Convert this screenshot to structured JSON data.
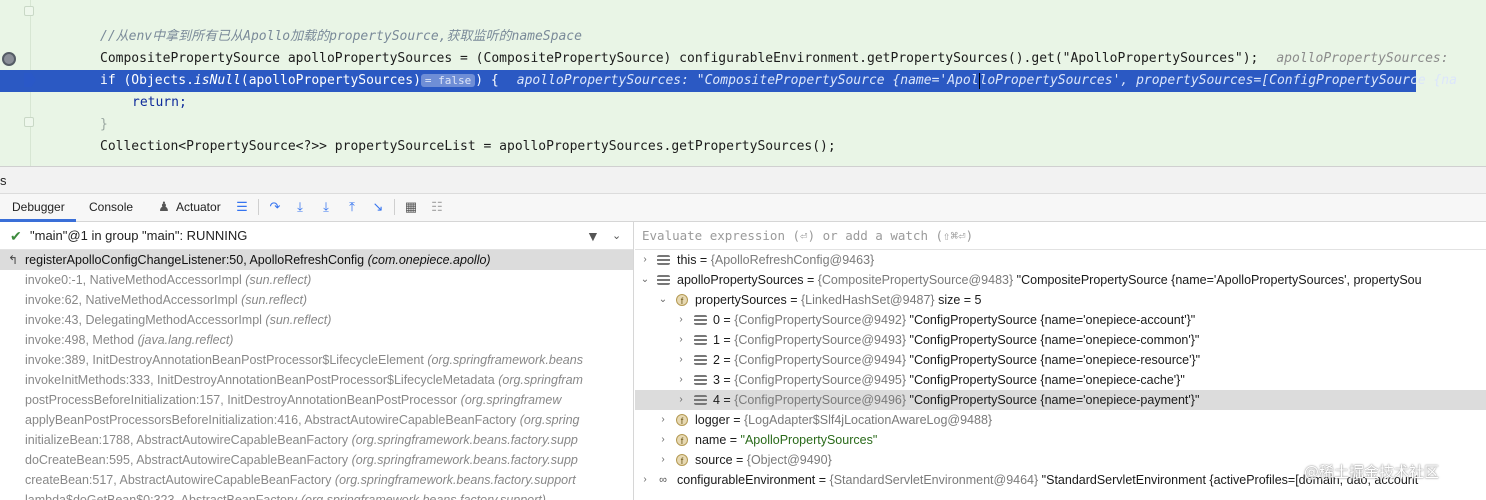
{
  "editor": {
    "comment": "//从env中拿到所有已从Apollo加载的propertySource,获取监听的nameSpace",
    "line2_code": "CompositePropertySource apolloPropertySources = (CompositePropertySource) configurableEnvironment.getPropertySources().get(\"ApolloPropertySources\");",
    "line2_hint": "apolloPropertySources:",
    "line3_code_a": "if (Objects.",
    "line3_code_b": "isNull",
    "line3_code_c": "(apolloPropertySources)",
    "line3_badge": "= false",
    "line3_code_d": ") {",
    "line3_hint_a": "apolloPropertySources: \"CompositePropertySource {name='Apol",
    "line3_hint_b": "loPropertySources', propertySources=[ConfigPropertySource {na",
    "line4": "return;",
    "line5": "}",
    "line6": "Collection<PropertySource<?>> propertySourceList = apolloPropertySources.getPropertySources();"
  },
  "tool_window": {
    "title": "s"
  },
  "tabs": {
    "debugger": "Debugger",
    "console": "Console",
    "actuator": "Actuator"
  },
  "toolbar_icons": [
    "show-execution-point-icon",
    "step-over-icon",
    "step-into-icon",
    "force-step-into-icon",
    "step-out-icon",
    "run-to-cursor-icon",
    "evaluate-expression-icon",
    "trace-icon"
  ],
  "thread": {
    "label": "\"main\"@1 in group \"main\": RUNNING"
  },
  "frames": [
    {
      "method": "registerApolloConfigChangeListener:50, ApolloRefreshConfig",
      "pkg": "(com.onepiece.apollo)",
      "selected": true
    },
    {
      "method": "invoke0:-1, NativeMethodAccessorImpl",
      "pkg": "(sun.reflect)"
    },
    {
      "method": "invoke:62, NativeMethodAccessorImpl",
      "pkg": "(sun.reflect)"
    },
    {
      "method": "invoke:43, DelegatingMethodAccessorImpl",
      "pkg": "(sun.reflect)"
    },
    {
      "method": "invoke:498, Method",
      "pkg": "(java.lang.reflect)"
    },
    {
      "method": "invoke:389, InitDestroyAnnotationBeanPostProcessor$LifecycleElement",
      "pkg": "(org.springframework.beans"
    },
    {
      "method": "invokeInitMethods:333, InitDestroyAnnotationBeanPostProcessor$LifecycleMetadata",
      "pkg": "(org.springfram"
    },
    {
      "method": "postProcessBeforeInitialization:157, InitDestroyAnnotationBeanPostProcessor",
      "pkg": "(org.springframew"
    },
    {
      "method": "applyBeanPostProcessorsBeforeInitialization:416, AbstractAutowireCapableBeanFactory",
      "pkg": "(org.spring"
    },
    {
      "method": "initializeBean:1788, AbstractAutowireCapableBeanFactory",
      "pkg": "(org.springframework.beans.factory.supp"
    },
    {
      "method": "doCreateBean:595, AbstractAutowireCapableBeanFactory",
      "pkg": "(org.springframework.beans.factory.supp"
    },
    {
      "method": "createBean:517, AbstractAutowireCapableBeanFactory",
      "pkg": "(org.springframework.beans.factory.support"
    },
    {
      "method": "lambda$doGetBean$0:323, AbstractBeanFactory",
      "pkg": "(org.springframework.beans.factory.support)"
    }
  ],
  "evaluate": {
    "placeholder": "Evaluate expression (⏎) or add a watch (⇧⌘⏎)"
  },
  "variables": {
    "this": {
      "name": "this",
      "ref": "{ApolloRefreshConfig@9463}"
    },
    "aps": {
      "name": "apolloPropertySources",
      "ref": "{CompositePropertySource@9483}",
      "value": "\"CompositePropertySource {name='ApolloPropertySources', propertySou"
    },
    "ps": {
      "name": "propertySources",
      "ref": "{LinkedHashSet@9487}",
      "extra": "size = 5"
    },
    "items": [
      {
        "idx": "0",
        "ref": "{ConfigPropertySource@9492}",
        "value": "\"ConfigPropertySource {name='onepiece-account'}\""
      },
      {
        "idx": "1",
        "ref": "{ConfigPropertySource@9493}",
        "value": "\"ConfigPropertySource {name='onepiece-common'}\""
      },
      {
        "idx": "2",
        "ref": "{ConfigPropertySource@9494}",
        "value": "\"ConfigPropertySource {name='onepiece-resource'}\""
      },
      {
        "idx": "3",
        "ref": "{ConfigPropertySource@9495}",
        "value": "\"ConfigPropertySource {name='onepiece-cache'}\""
      },
      {
        "idx": "4",
        "ref": "{ConfigPropertySource@9496}",
        "value": "\"ConfigPropertySource {name='onepiece-payment'}\""
      }
    ],
    "logger": {
      "name": "logger",
      "ref": "{LogAdapter$Slf4jLocationAwareLog@9488}"
    },
    "name": {
      "name": "name",
      "value": "\"ApolloPropertySources\""
    },
    "source": {
      "name": "source",
      "ref": "{Object@9490}"
    },
    "env": {
      "name": "configurableEnvironment",
      "ref": "{StandardServletEnvironment@9464}",
      "value": "\"StandardServletEnvironment {activeProfiles=[domain, dao, account"
    }
  },
  "watermark": "@稀土掘金技术社区"
}
